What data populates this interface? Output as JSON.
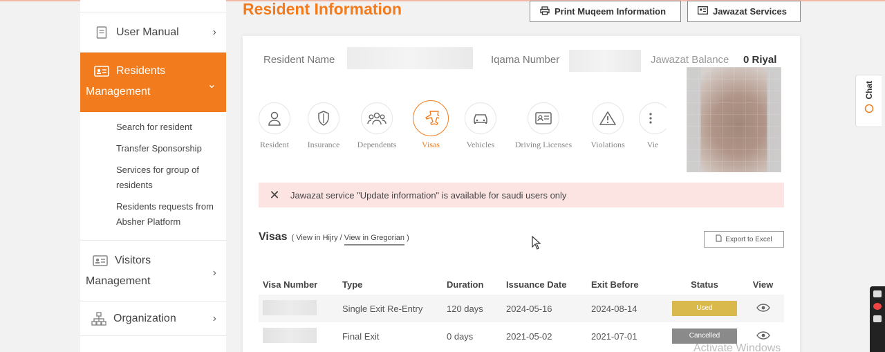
{
  "sidebar": {
    "items": [
      {
        "label": "User Manual",
        "icon": "book-icon"
      },
      {
        "label_line1": "Residents",
        "label_line2": "Management",
        "icon": "id-card-icon",
        "active": true
      },
      {
        "label_line1": "Visitors",
        "label_line2": "Management",
        "icon": "id-card-icon"
      },
      {
        "label": "Organization",
        "icon": "org-chart-icon"
      }
    ],
    "sub_items": [
      "Search for resident",
      "Transfer Sponsorship",
      "Services for group of residents",
      "Residents requests from Absher Platform"
    ]
  },
  "header": {
    "title": "Resident Information",
    "print_label": "Print Muqeem Information",
    "jawazat_label": "Jawazat Services"
  },
  "info": {
    "resident_name_label": "Resident Name",
    "iqama_label": "Iqama Number",
    "balance_label": "Jawazat Balance",
    "balance_value": "0 Riyal"
  },
  "tabs": [
    {
      "label": "Resident",
      "icon": "person-icon"
    },
    {
      "label": "Insurance",
      "icon": "shield-icon"
    },
    {
      "label": "Dependents",
      "icon": "group-icon"
    },
    {
      "label": "Visas",
      "icon": "plane-icon",
      "active": true
    },
    {
      "label": "Vehicles",
      "icon": "car-icon"
    },
    {
      "label": "Driving Licenses",
      "icon": "license-card-icon"
    },
    {
      "label": "Violations",
      "icon": "warning-icon"
    },
    {
      "label": "Vie",
      "icon": "list-icon"
    }
  ],
  "alert": {
    "message": "Jawazat service \"Update information\" is available for saudi users only"
  },
  "visas": {
    "title": "Visas",
    "open_paren": "(",
    "hijri_link": "View in Hijry",
    "separator": "/",
    "gregorian_link": "View in Gregorian",
    "close_paren": ")",
    "export_label": "Export to Excel",
    "columns": [
      "Visa Number",
      "Type",
      "Duration",
      "Issuance Date",
      "Exit Before",
      "Status",
      "View"
    ],
    "rows": [
      {
        "type": "Single Exit Re-Entry",
        "duration": "120 days",
        "issuance": "2024-05-16",
        "exit_before": "2024-08-14",
        "status": "Used",
        "status_color": "#d9b94c"
      },
      {
        "type": "Final Exit",
        "duration": "0 days",
        "issuance": "2021-05-02",
        "exit_before": "2021-07-01",
        "status": "Cancelled",
        "status_color": "#8a8a8a"
      }
    ]
  },
  "chat": {
    "label": "Chat"
  },
  "watermark": "Activate Windows",
  "colors": {
    "accent": "#f27c1d",
    "alert_bg": "#fbe4e2"
  }
}
